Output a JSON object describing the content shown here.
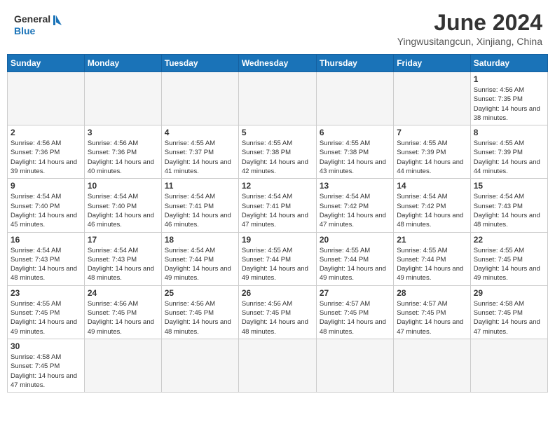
{
  "header": {
    "logo_general": "General",
    "logo_blue": "Blue",
    "month_title": "June 2024",
    "location": "Yingwusitangcun, Xinjiang, China"
  },
  "days_of_week": [
    "Sunday",
    "Monday",
    "Tuesday",
    "Wednesday",
    "Thursday",
    "Friday",
    "Saturday"
  ],
  "weeks": [
    [
      {
        "day": "",
        "info": ""
      },
      {
        "day": "",
        "info": ""
      },
      {
        "day": "",
        "info": ""
      },
      {
        "day": "",
        "info": ""
      },
      {
        "day": "",
        "info": ""
      },
      {
        "day": "",
        "info": ""
      },
      {
        "day": "1",
        "info": "Sunrise: 4:56 AM\nSunset: 7:35 PM\nDaylight: 14 hours and 38 minutes."
      }
    ],
    [
      {
        "day": "2",
        "info": "Sunrise: 4:56 AM\nSunset: 7:36 PM\nDaylight: 14 hours and 39 minutes."
      },
      {
        "day": "3",
        "info": "Sunrise: 4:56 AM\nSunset: 7:36 PM\nDaylight: 14 hours and 40 minutes."
      },
      {
        "day": "4",
        "info": "Sunrise: 4:55 AM\nSunset: 7:37 PM\nDaylight: 14 hours and 41 minutes."
      },
      {
        "day": "5",
        "info": "Sunrise: 4:55 AM\nSunset: 7:38 PM\nDaylight: 14 hours and 42 minutes."
      },
      {
        "day": "6",
        "info": "Sunrise: 4:55 AM\nSunset: 7:38 PM\nDaylight: 14 hours and 43 minutes."
      },
      {
        "day": "7",
        "info": "Sunrise: 4:55 AM\nSunset: 7:39 PM\nDaylight: 14 hours and 44 minutes."
      },
      {
        "day": "8",
        "info": "Sunrise: 4:55 AM\nSunset: 7:39 PM\nDaylight: 14 hours and 44 minutes."
      }
    ],
    [
      {
        "day": "9",
        "info": "Sunrise: 4:54 AM\nSunset: 7:40 PM\nDaylight: 14 hours and 45 minutes."
      },
      {
        "day": "10",
        "info": "Sunrise: 4:54 AM\nSunset: 7:40 PM\nDaylight: 14 hours and 46 minutes."
      },
      {
        "day": "11",
        "info": "Sunrise: 4:54 AM\nSunset: 7:41 PM\nDaylight: 14 hours and 46 minutes."
      },
      {
        "day": "12",
        "info": "Sunrise: 4:54 AM\nSunset: 7:41 PM\nDaylight: 14 hours and 47 minutes."
      },
      {
        "day": "13",
        "info": "Sunrise: 4:54 AM\nSunset: 7:42 PM\nDaylight: 14 hours and 47 minutes."
      },
      {
        "day": "14",
        "info": "Sunrise: 4:54 AM\nSunset: 7:42 PM\nDaylight: 14 hours and 48 minutes."
      },
      {
        "day": "15",
        "info": "Sunrise: 4:54 AM\nSunset: 7:43 PM\nDaylight: 14 hours and 48 minutes."
      }
    ],
    [
      {
        "day": "16",
        "info": "Sunrise: 4:54 AM\nSunset: 7:43 PM\nDaylight: 14 hours and 48 minutes."
      },
      {
        "day": "17",
        "info": "Sunrise: 4:54 AM\nSunset: 7:43 PM\nDaylight: 14 hours and 48 minutes."
      },
      {
        "day": "18",
        "info": "Sunrise: 4:54 AM\nSunset: 7:44 PM\nDaylight: 14 hours and 49 minutes."
      },
      {
        "day": "19",
        "info": "Sunrise: 4:55 AM\nSunset: 7:44 PM\nDaylight: 14 hours and 49 minutes."
      },
      {
        "day": "20",
        "info": "Sunrise: 4:55 AM\nSunset: 7:44 PM\nDaylight: 14 hours and 49 minutes."
      },
      {
        "day": "21",
        "info": "Sunrise: 4:55 AM\nSunset: 7:44 PM\nDaylight: 14 hours and 49 minutes."
      },
      {
        "day": "22",
        "info": "Sunrise: 4:55 AM\nSunset: 7:45 PM\nDaylight: 14 hours and 49 minutes."
      }
    ],
    [
      {
        "day": "23",
        "info": "Sunrise: 4:55 AM\nSunset: 7:45 PM\nDaylight: 14 hours and 49 minutes."
      },
      {
        "day": "24",
        "info": "Sunrise: 4:56 AM\nSunset: 7:45 PM\nDaylight: 14 hours and 49 minutes."
      },
      {
        "day": "25",
        "info": "Sunrise: 4:56 AM\nSunset: 7:45 PM\nDaylight: 14 hours and 48 minutes."
      },
      {
        "day": "26",
        "info": "Sunrise: 4:56 AM\nSunset: 7:45 PM\nDaylight: 14 hours and 48 minutes."
      },
      {
        "day": "27",
        "info": "Sunrise: 4:57 AM\nSunset: 7:45 PM\nDaylight: 14 hours and 48 minutes."
      },
      {
        "day": "28",
        "info": "Sunrise: 4:57 AM\nSunset: 7:45 PM\nDaylight: 14 hours and 47 minutes."
      },
      {
        "day": "29",
        "info": "Sunrise: 4:58 AM\nSunset: 7:45 PM\nDaylight: 14 hours and 47 minutes."
      }
    ],
    [
      {
        "day": "30",
        "info": "Sunrise: 4:58 AM\nSunset: 7:45 PM\nDaylight: 14 hours and 47 minutes."
      },
      {
        "day": "",
        "info": ""
      },
      {
        "day": "",
        "info": ""
      },
      {
        "day": "",
        "info": ""
      },
      {
        "day": "",
        "info": ""
      },
      {
        "day": "",
        "info": ""
      },
      {
        "day": "",
        "info": ""
      }
    ]
  ]
}
